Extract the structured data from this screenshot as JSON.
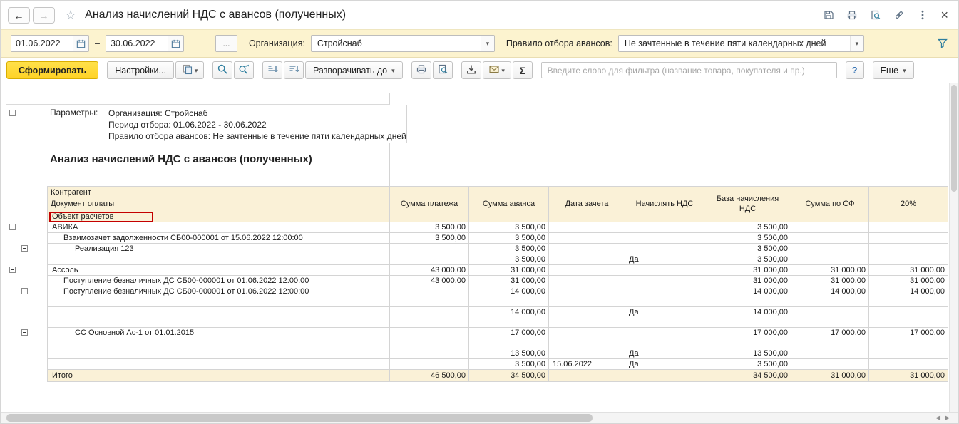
{
  "titlebar": {
    "title": "Анализ начислений НДС с авансов (полученных)"
  },
  "icons": {
    "back": "←",
    "forward": "→",
    "star": "☆",
    "close": "×",
    "caret": "▾",
    "left": "◀",
    "right": "▶"
  },
  "filterbar": {
    "date_from": "01.06.2022",
    "dash": "–",
    "date_to": "30.06.2022",
    "ellipsis_button": "...",
    "org_label": "Организация:",
    "org_value": "Стройснаб",
    "rule_label": "Правило отбора авансов:",
    "rule_value": "Не зачтенные в течение пяти календарных дней"
  },
  "toolbar": {
    "generate_button": "Сформировать",
    "settings_button": "Настройки...",
    "expand_to_button": "Разворачивать до",
    "filter_placeholder": "Введите слово для фильтра (название товара, покупателя и пр.)",
    "help_button": "?",
    "more_button": "Еще",
    "sigma": "Σ"
  },
  "report": {
    "params_label": "Параметры:",
    "params": [
      "Организация: Стройснаб",
      "Период отбора: 01.06.2022 - 30.06.2022",
      "Правило отбора авансов: Не зачтенные в течение пяти календарных дней"
    ],
    "title": "Анализ начислений НДС с авансов (полученных)",
    "row_headers": [
      "Контрагент",
      "Документ оплаты",
      "Объект расчетов"
    ],
    "columns": [
      "Сумма платежа",
      "Сумма аванса",
      "Дата зачета",
      "Начислять НДС",
      "База начисления НДС",
      "Сумма по СФ",
      "20%"
    ],
    "rows": [
      {
        "label": "АВИКА",
        "indent": 0,
        "expander": 1,
        "cells": [
          "3 500,00",
          "3 500,00",
          "",
          "",
          "3 500,00",
          "",
          ""
        ]
      },
      {
        "label": "Взаимозачет задолженности СБ00-000001 от 15.06.2022 12:00:00",
        "indent": 1,
        "cells": [
          "3 500,00",
          "3 500,00",
          "",
          "",
          "3 500,00",
          "",
          ""
        ]
      },
      {
        "label": "Реализация 123",
        "indent": 2,
        "expander": 2,
        "cells": [
          "",
          "3 500,00",
          "",
          "",
          "3 500,00",
          "",
          ""
        ]
      },
      {
        "label": "",
        "indent": 2,
        "cells": [
          "",
          "3 500,00",
          "",
          "Да",
          "3 500,00",
          "",
          ""
        ]
      },
      {
        "label": "Ассоль",
        "indent": 0,
        "expander": 1,
        "cells": [
          "43 000,00",
          "31 000,00",
          "",
          "",
          "31 000,00",
          "31 000,00",
          "31 000,00"
        ]
      },
      {
        "label": "Поступление безналичных ДС СБ00-000001 от 01.06.2022 12:00:00",
        "indent": 1,
        "cells": [
          "43 000,00",
          "31 000,00",
          "",
          "",
          "31 000,00",
          "31 000,00",
          "31 000,00"
        ]
      },
      {
        "label": "Поступление безналичных ДС СБ00-000001 от 01.06.2022 12:00:00",
        "indent": 1,
        "expander": 2,
        "tall": true,
        "cells": [
          "",
          "14 000,00",
          "",
          "",
          "14 000,00",
          "14 000,00",
          "14 000,00"
        ]
      },
      {
        "label": "",
        "indent": 2,
        "tall": true,
        "cells": [
          "",
          "14 000,00",
          "",
          "Да",
          "14 000,00",
          "",
          ""
        ]
      },
      {
        "label": "СС Основной Ас-1 от 01.01.2015",
        "indent": 2,
        "expander": 2,
        "tall": true,
        "cells": [
          "",
          "17 000,00",
          "",
          "",
          "17 000,00",
          "17 000,00",
          "17 000,00"
        ]
      },
      {
        "label": "",
        "indent": 2,
        "cells": [
          "",
          "13 500,00",
          "",
          "Да",
          "13 500,00",
          "",
          ""
        ]
      },
      {
        "label": "",
        "indent": 2,
        "cells": [
          "",
          "3 500,00",
          "15.06.2022",
          "Да",
          "3 500,00",
          "",
          ""
        ]
      },
      {
        "label": "Итого",
        "indent": 0,
        "total": true,
        "cells": [
          "46 500,00",
          "34 500,00",
          "",
          "",
          "34 500,00",
          "31 000,00",
          "31 000,00"
        ]
      }
    ]
  }
}
